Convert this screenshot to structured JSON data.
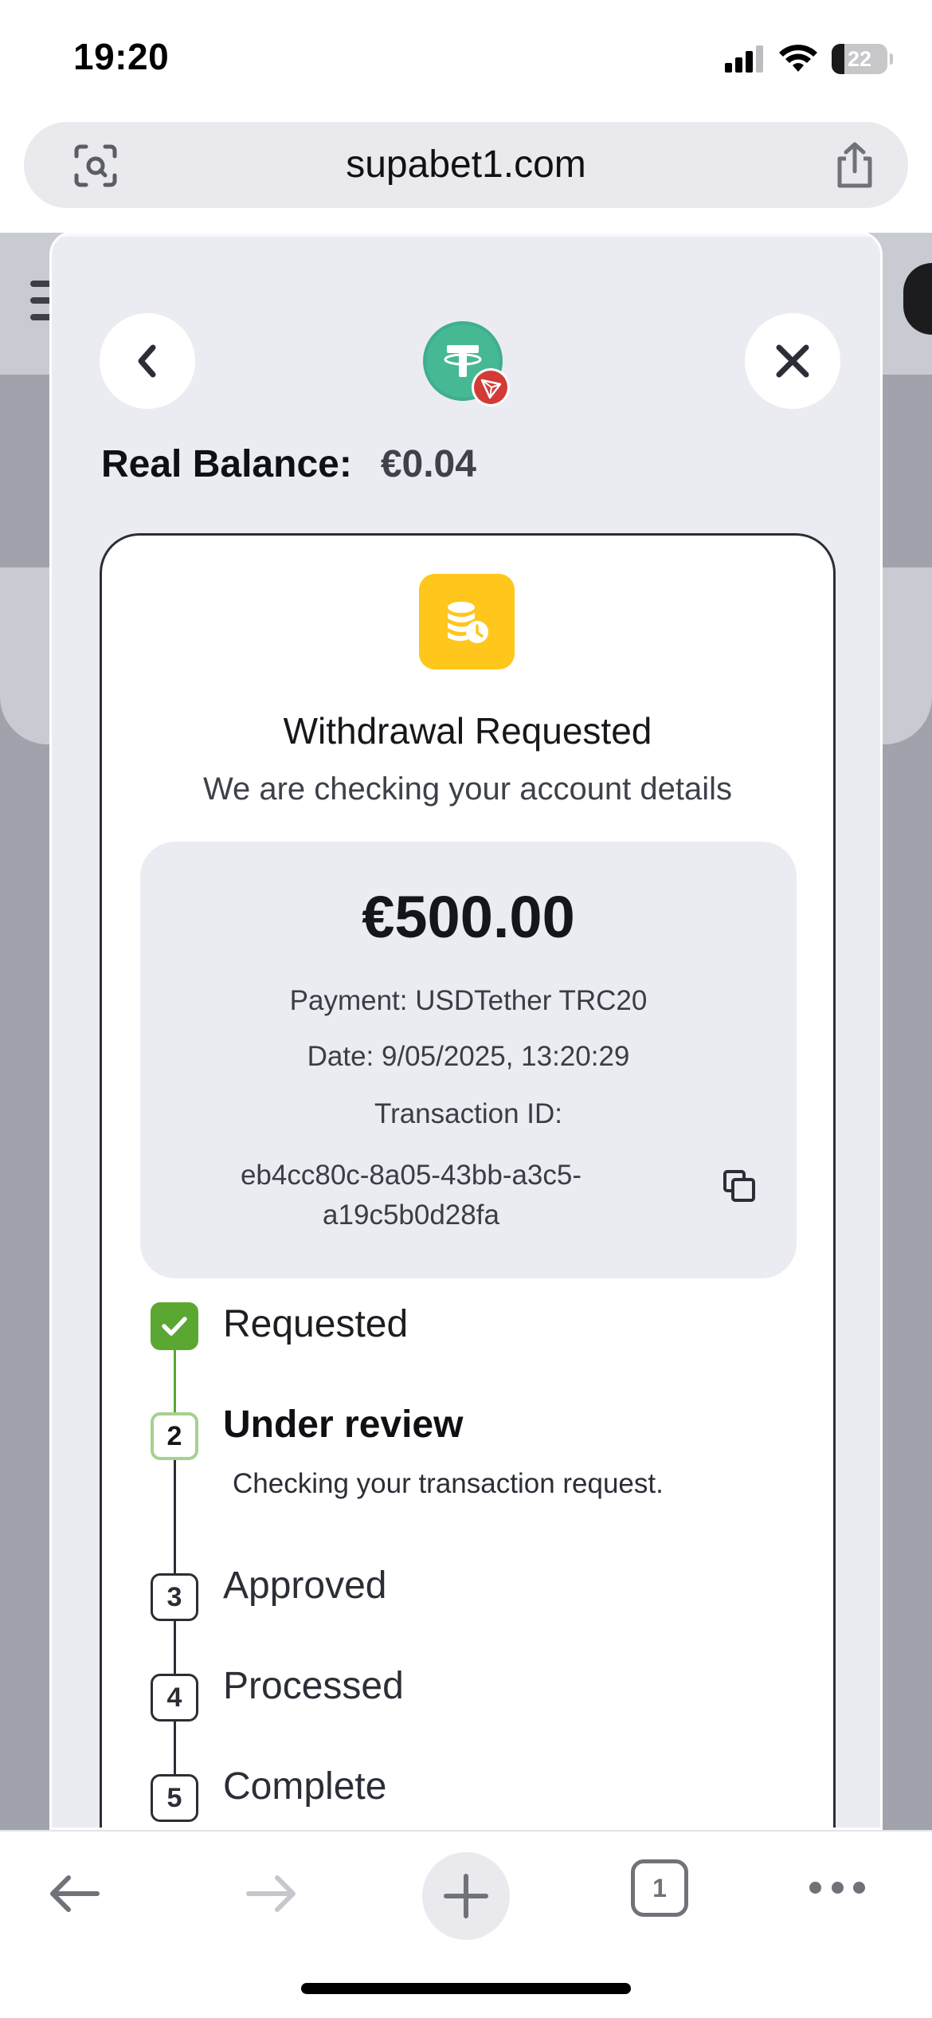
{
  "status_bar": {
    "time": "19:20",
    "battery": "22",
    "icons": [
      "cellular-signal-icon",
      "wifi-icon",
      "battery-icon"
    ]
  },
  "browser": {
    "url": "supabet1.com",
    "left_icon": "camera-search-icon",
    "right_icon": "share-icon",
    "tab_count": "1",
    "toolbar_icons": [
      "back-arrow-icon",
      "forward-arrow-icon",
      "plus-icon",
      "tabs-icon",
      "more-icon"
    ]
  },
  "modal": {
    "currency_icon": "tether-trc20-logo",
    "balance_label": "Real Balance:",
    "balance_value": "€0.04",
    "status_icon": "coins-clock-icon",
    "title": "Withdrawal Requested",
    "subtitle": "We are checking your account details",
    "amount": "€500.00",
    "payment": "Payment: USDTether TRC20",
    "date": "Date: 9/05/2025, 13:20:29",
    "transaction_label": "Transaction ID:",
    "transaction_id": "eb4cc80c-8a05-43bb-a3c5-a19c5b0d28fa",
    "steps": [
      {
        "label": "Requested",
        "state": "done"
      },
      {
        "number": "2",
        "label": "Under review",
        "state": "active",
        "description": "Checking your transaction request."
      },
      {
        "number": "3",
        "label": "Approved",
        "state": "pending"
      },
      {
        "number": "4",
        "label": "Processed",
        "state": "pending"
      },
      {
        "number": "5",
        "label": "Complete",
        "state": "pending"
      }
    ]
  },
  "colors": {
    "accent_green": "#5aa832",
    "status_yellow": "#ffc61b",
    "tether_green": "#3fae8f",
    "tron_red": "#d23b36"
  }
}
